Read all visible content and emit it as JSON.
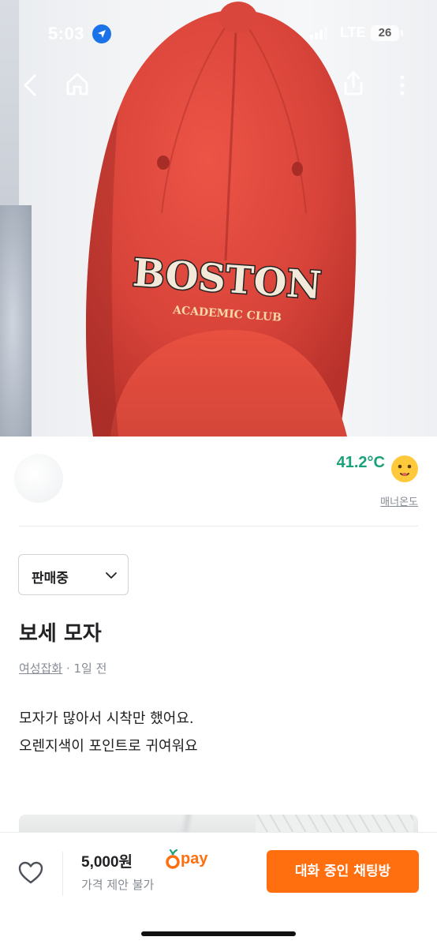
{
  "status_bar": {
    "time": "5:03",
    "network": "LTE",
    "battery": "26"
  },
  "icons": {
    "back": "chevron-left-icon",
    "home": "home-icon",
    "share": "share-icon",
    "more": "more-vertical-icon",
    "like": "heart-icon"
  },
  "hero_image": {
    "cap_text_main": "BOSTON",
    "cap_text_sub": "ACADEMIC CLUB",
    "cap_color": "#e0463a"
  },
  "seller": {
    "manner_temperature": "41.2°C",
    "manner_label": "매너온도",
    "temperature_color": "#1aa17a"
  },
  "listing": {
    "status": "판매중",
    "title": "보세 모자",
    "category": "여성잡화",
    "separator": " · ",
    "posted": "1일 전",
    "description": [
      "모자가 많아서 시착만 했어요.",
      "오렌지색이 포인트로 귀여워요"
    ]
  },
  "bottom_bar": {
    "price": "5,000원",
    "pay_label": "pay",
    "offer_note": "가격 제안 불가",
    "chat_button": "대화 중인 채팅방",
    "accent_color": "#ff6f0f"
  }
}
